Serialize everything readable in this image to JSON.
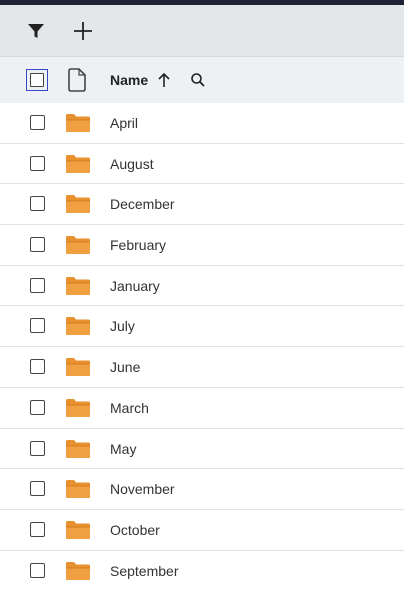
{
  "toolbar": {
    "filter_icon": "filter-icon",
    "add_icon": "plus-icon"
  },
  "header": {
    "column_name": "Name",
    "sort_direction": "ascending",
    "sort_icon": "arrow-up-icon",
    "search_icon": "search-icon",
    "type_icon": "document-icon"
  },
  "items": [
    {
      "name": "April",
      "type": "folder"
    },
    {
      "name": "August",
      "type": "folder"
    },
    {
      "name": "December",
      "type": "folder"
    },
    {
      "name": "February",
      "type": "folder"
    },
    {
      "name": "January",
      "type": "folder"
    },
    {
      "name": "July",
      "type": "folder"
    },
    {
      "name": "June",
      "type": "folder"
    },
    {
      "name": "March",
      "type": "folder"
    },
    {
      "name": "May",
      "type": "folder"
    },
    {
      "name": "November",
      "type": "folder"
    },
    {
      "name": "October",
      "type": "folder"
    },
    {
      "name": "September",
      "type": "folder"
    }
  ],
  "colors": {
    "folder": "#e8912e",
    "toolbar_bg": "#e3e7ea",
    "header_bg": "#eef1f3",
    "focus_outline": "#3548c5"
  }
}
